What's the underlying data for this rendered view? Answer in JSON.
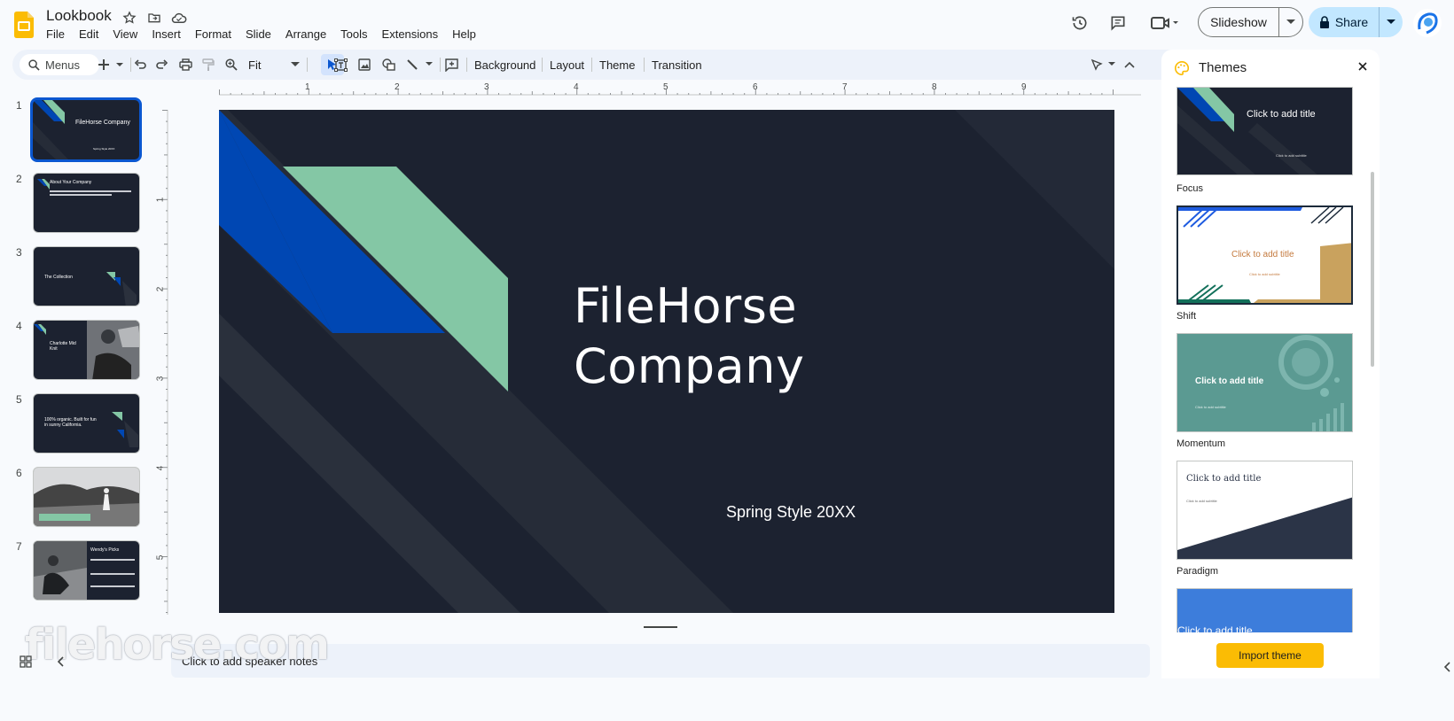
{
  "header": {
    "title": "Lookbook",
    "menu": [
      "File",
      "Edit",
      "View",
      "Insert",
      "Format",
      "Slide",
      "Arrange",
      "Tools",
      "Extensions",
      "Help"
    ],
    "slideshow_label": "Slideshow",
    "share_label": "Share"
  },
  "toolbar": {
    "menus_placeholder": "Menus",
    "zoom": "Fit",
    "background_label": "Background",
    "layout_label": "Layout",
    "theme_label": "Theme",
    "transition_label": "Transition"
  },
  "rulers": {
    "h": [
      "1",
      "2",
      "3",
      "4",
      "5",
      "6",
      "7",
      "8",
      "9"
    ],
    "v": [
      "1",
      "2",
      "3",
      "4",
      "5"
    ]
  },
  "filmstrip": [
    {
      "num": "1",
      "title": "FileHorse Company",
      "sub": "Spring Style 20XX"
    },
    {
      "num": "2",
      "title": "About Your Company",
      "sub": ""
    },
    {
      "num": "3",
      "title": "The Collection",
      "sub": ""
    },
    {
      "num": "4",
      "title": "Charlotte Mid Knit",
      "sub": ""
    },
    {
      "num": "5",
      "title": "100% organic. Built for fun in sunny California.",
      "sub": ""
    },
    {
      "num": "6",
      "title": "",
      "sub": ""
    },
    {
      "num": "7",
      "title": "Wendy's Picks",
      "sub": ""
    }
  ],
  "slide": {
    "title_line1": "FileHorse",
    "title_line2": "Company",
    "subtitle": "Spring Style 20XX"
  },
  "notes_placeholder": "Click to add speaker notes",
  "watermark": "filehorse.com",
  "themes_panel": {
    "title": "Themes",
    "themes": [
      {
        "name": "Focus",
        "preview_title": "Click to add title",
        "preview_sub": "Click to add subtitle"
      },
      {
        "name": "Shift",
        "preview_title": "Click to add title",
        "preview_sub": "Click to add subtitle"
      },
      {
        "name": "Momentum",
        "preview_title": "Click to add title",
        "preview_sub": "Click to add subtitle"
      },
      {
        "name": "Paradigm",
        "preview_title": "Click to add title",
        "preview_sub": "Click to add subtitle"
      },
      {
        "name": "",
        "preview_title": "Click to add title",
        "preview_sub": ""
      }
    ],
    "import_label": "Import theme"
  },
  "colors": {
    "slide_bg": "#1c2230",
    "accent_blue": "#0047b3",
    "accent_green": "#84c7a5",
    "brand_yellow": "#fbbc04",
    "selection_blue": "#0b57d0"
  }
}
